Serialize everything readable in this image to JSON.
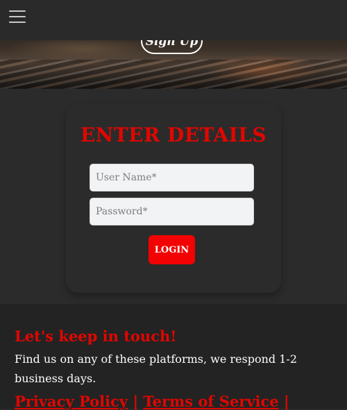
{
  "header": {
    "menu_icon": "hamburger-menu-icon",
    "signup_label": "Sign Up"
  },
  "form": {
    "title": "ENTER DETAILS",
    "username_placeholder": "User Name*",
    "password_placeholder": "Password*",
    "login_label": "LOGIN"
  },
  "footer": {
    "heading": "Let's keep in touch!",
    "text": "Find us on any of these platforms, we respond 1-2 business days.",
    "links": {
      "privacy": "Privacy Policy",
      "separator": "|",
      "terms": "Terms of Service",
      "trailing_separator": "|"
    }
  },
  "colors": {
    "accent": "#e10600",
    "button": "#f20202",
    "background": "#2b2b2b"
  }
}
